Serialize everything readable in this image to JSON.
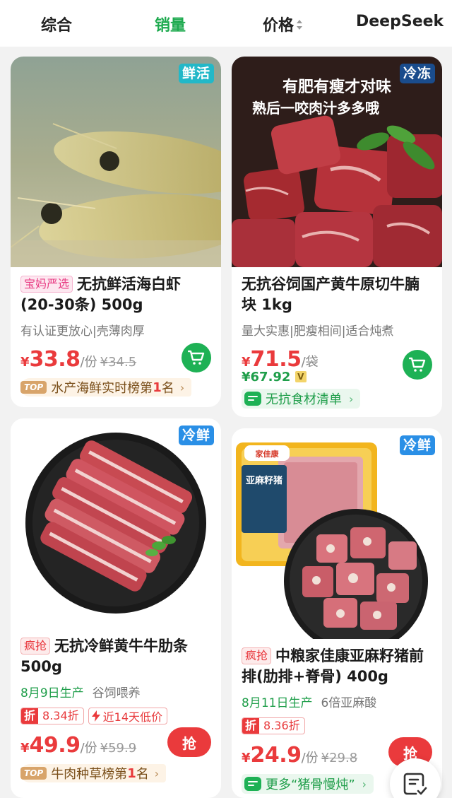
{
  "sort_tabs": [
    {
      "label": "综合",
      "active": false
    },
    {
      "label": "销量",
      "active": true
    },
    {
      "label": "价格",
      "active": false,
      "icon": "sort-arrows-icon"
    },
    {
      "label": "DeepSeek",
      "active": false
    }
  ],
  "colors": {
    "accent_green": "#1eaa4f",
    "price_red": "#ea3a3c"
  },
  "products": [
    {
      "temp_tag": "鲜活",
      "badge": "宝妈严选",
      "title": "无抗鲜活海白虾(20-30条) 500g",
      "subtitle": "有认证更放心|壳薄肉厚",
      "currency": "¥",
      "price": "33.8",
      "unit": "/份",
      "old_price": "¥34.5",
      "action_icon": "cart-icon",
      "rank": {
        "top": "TOP",
        "prefix": "水产海鲜实时榜第",
        "num": "1",
        "suffix": "名",
        "chevron": "›"
      }
    },
    {
      "temp_tag": "冷冻",
      "image_text_line1": "有肥有瘦才对味",
      "image_text_line2": "熟后一咬肉汁多多哦",
      "title": "无抗谷饲国产黄牛原切牛腩块 1kg",
      "subtitle": "量大实惠|肥瘦相间|适合炖煮",
      "currency": "¥",
      "price": "71.5",
      "unit": "/袋",
      "member_price": "¥67.92",
      "member_badge": "V",
      "action_icon": "cart-icon",
      "pill": {
        "text": "无抗食材清单",
        "chevron": "›"
      }
    },
    {
      "temp_tag": "冷鲜",
      "badge": "疯抢",
      "title": "无抗冷鲜黄牛牛肋条500g",
      "production_date": "8月9日生产",
      "feature": "谷饲喂养",
      "discount_label": "折",
      "discount_value": "8.34折",
      "low_price": "近14天低价",
      "currency": "¥",
      "price": "49.9",
      "unit": "/份",
      "old_price": "¥59.9",
      "action_label": "抢",
      "rank": {
        "top": "TOP",
        "prefix": "牛肉种草榜第",
        "num": "1",
        "suffix": "名",
        "chevron": "›"
      }
    },
    {
      "temp_tag": "冷鲜",
      "badge": "疯抢",
      "title": "中粮家佳康亚麻籽猪前排(肋排+脊骨) 400g",
      "production_date": "8月11日生产",
      "feature": "6倍亚麻酸",
      "discount_label": "折",
      "discount_value": "8.36折",
      "package_brand": "家佳康",
      "package_title": "亚麻籽猪",
      "currency": "¥",
      "price": "24.9",
      "unit": "/份",
      "old_price": "¥29.8",
      "action_label": "抢",
      "pill": {
        "text": "更多“猪骨慢炖”",
        "chevron": "›"
      }
    }
  ]
}
